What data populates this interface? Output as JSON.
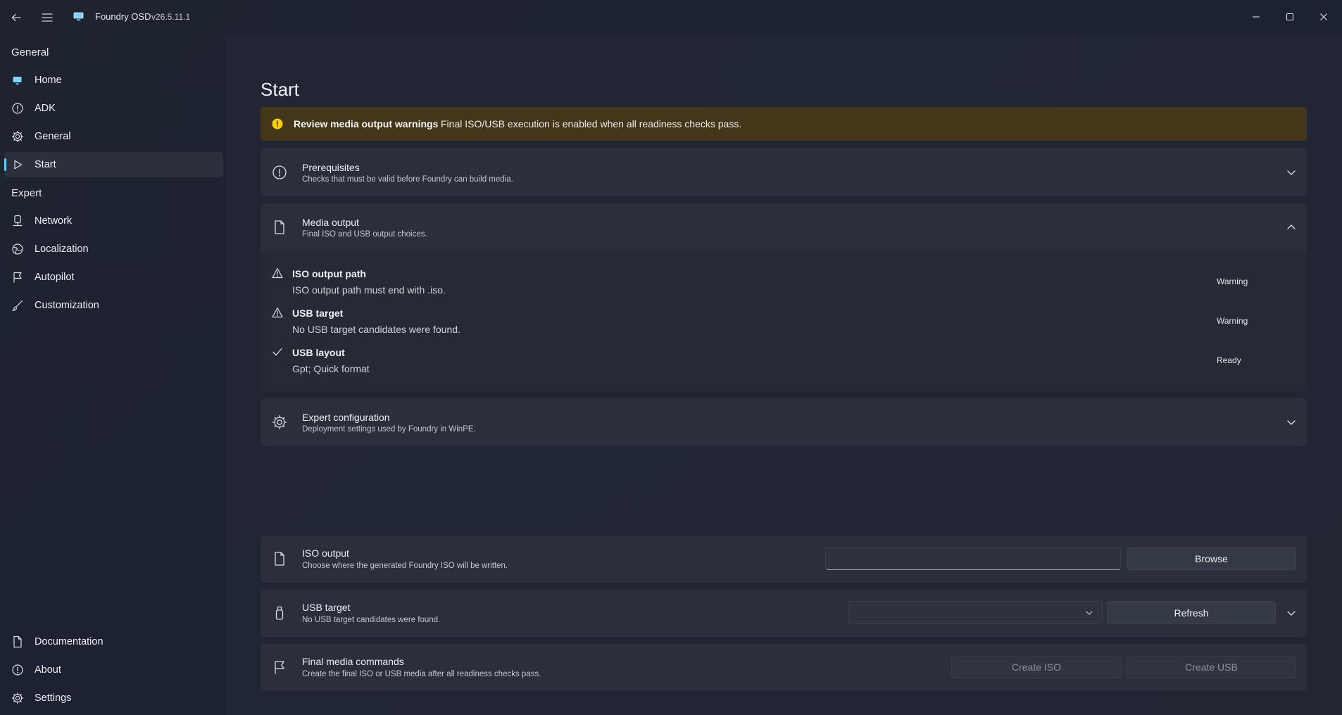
{
  "titlebar": {
    "app_name": "Foundry OSD",
    "version": "v26.5.11.1"
  },
  "sidebar": {
    "sections": [
      {
        "label": "General"
      },
      {
        "label": "Expert"
      }
    ],
    "items": [
      {
        "label": "Home",
        "icon": "monitor-icon"
      },
      {
        "label": "ADK",
        "icon": "info-icon"
      },
      {
        "label": "General",
        "icon": "gear-icon"
      },
      {
        "label": "Start",
        "icon": "play-icon",
        "active": true
      },
      {
        "label": "Network",
        "icon": "network-icon"
      },
      {
        "label": "Localization",
        "icon": "globe-icon"
      },
      {
        "label": "Autopilot",
        "icon": "flag-icon"
      },
      {
        "label": "Customization",
        "icon": "brush-icon"
      }
    ],
    "footer_items": [
      {
        "label": "Documentation",
        "icon": "document-icon"
      },
      {
        "label": "About",
        "icon": "info-icon"
      },
      {
        "label": "Settings",
        "icon": "gear-icon"
      }
    ]
  },
  "page": {
    "title": "Start"
  },
  "banner": {
    "title": "Review media output warnings",
    "message": "Final ISO/USB execution is enabled when all readiness checks pass.",
    "color": "#443719"
  },
  "cards": {
    "prerequisites": {
      "title": "Prerequisites",
      "subtitle": "Checks that must be valid before Foundry can build media."
    },
    "media_output": {
      "title": "Media output",
      "subtitle": "Final ISO and USB output choices.",
      "checks": [
        {
          "title": "ISO output path",
          "detail": "ISO output path must end with .iso.",
          "status": "Warning",
          "icon": "warning-icon"
        },
        {
          "title": "USB target",
          "detail": "No USB target candidates were found.",
          "status": "Warning",
          "icon": "warning-icon"
        },
        {
          "title": "USB layout",
          "detail": "Gpt; Quick format",
          "status": "Ready",
          "icon": "checkmark-icon"
        }
      ]
    },
    "expert_configuration": {
      "title": "Expert configuration",
      "subtitle": "Deployment settings used by Foundry in WinPE."
    }
  },
  "bottom": {
    "iso_output": {
      "title": "ISO output",
      "subtitle": "Choose where the generated Foundry ISO will be written.",
      "path_value": "",
      "browse_label": "Browse"
    },
    "usb_target": {
      "title": "USB target",
      "subtitle": "No USB target candidates were found.",
      "selected": "",
      "refresh_label": "Refresh"
    },
    "final_commands": {
      "title": "Final media commands",
      "subtitle": "Create the final ISO or USB media after all readiness checks pass.",
      "create_iso_label": "Create ISO",
      "create_usb_label": "Create USB"
    }
  },
  "colors": {
    "accent": "#60cdff",
    "warning_dot": "#f7d000"
  }
}
